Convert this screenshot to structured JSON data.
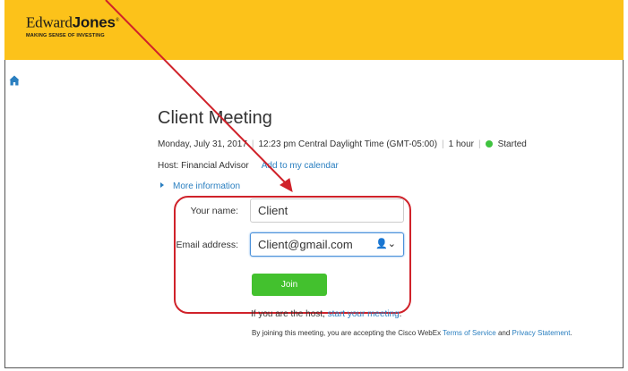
{
  "brand": {
    "name_regular": "Edward",
    "name_bold": "Jones",
    "tagline": "MAKING SENSE OF INVESTING",
    "color": "#fcc21a"
  },
  "nav": {
    "home_icon": "home-icon"
  },
  "meeting": {
    "title": "Client Meeting",
    "date": "Monday, July 31, 2017",
    "time": "12:23 pm Central Daylight Time (GMT-05:00)",
    "duration": "1 hour",
    "status": "Started",
    "host": "Host: Financial Advisor",
    "add_calendar": "Add to my calendar",
    "more_info": "More information"
  },
  "form": {
    "name_label": "Your name:",
    "name_value": "Client",
    "email_label": "Email address:",
    "email_value": "Client@gmail.com",
    "user_icon_glyph": "👤⌄",
    "join_label": "Join"
  },
  "footer": {
    "host_text": "If you are the host, ",
    "host_link": "start your meeting",
    "host_end": ".",
    "terms_text": "By joining this meeting, you are accepting the Cisco WebEx ",
    "terms_link": "Terms of Service",
    "terms_and": " and ",
    "privacy_link": "Privacy Statement",
    "terms_end": "."
  },
  "annotation": {
    "color": "#d0222a"
  }
}
